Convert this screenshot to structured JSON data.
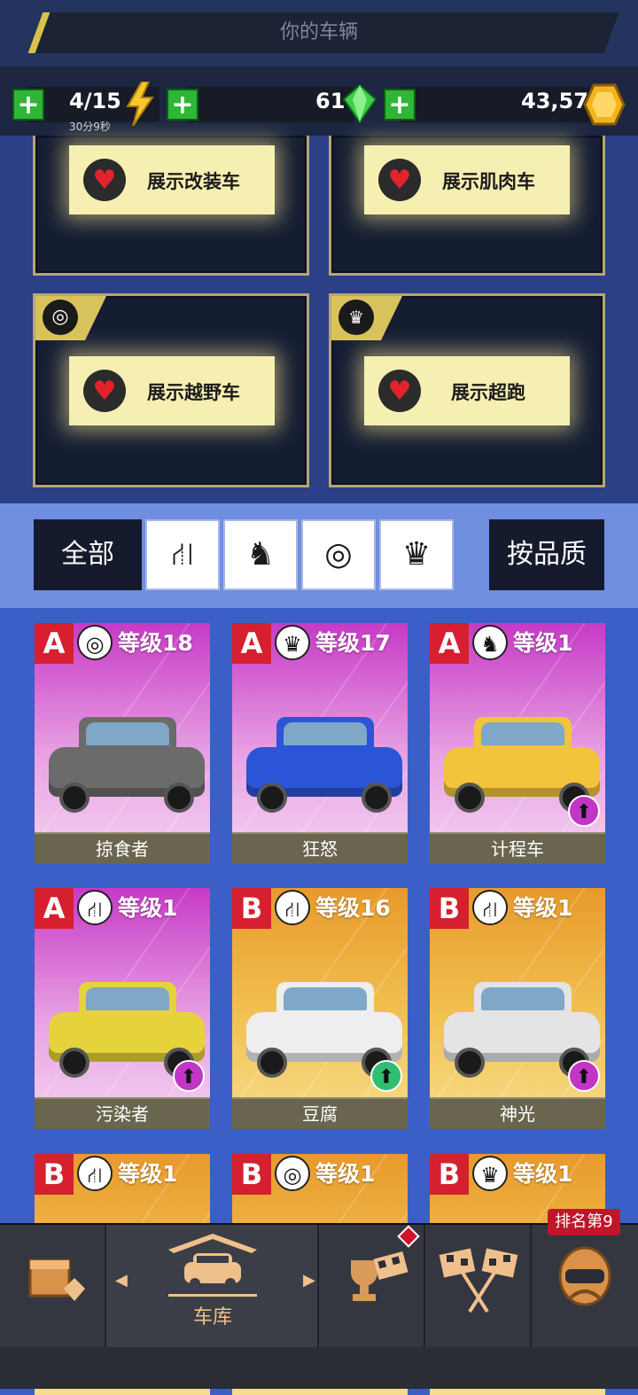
{
  "header": {
    "title": "你的车辆"
  },
  "resources": {
    "energy": {
      "value": "4/15",
      "timer": "30分9秒"
    },
    "gems": {
      "value": "61"
    },
    "coins": {
      "value": "43,577"
    }
  },
  "showcase": [
    {
      "label": "展示改装车",
      "icon": ""
    },
    {
      "label": "展示肌肉车",
      "icon": ""
    },
    {
      "label": "展示越野车",
      "icon": "wheel-icon"
    },
    {
      "label": "展示超跑",
      "icon": "crown-icon"
    }
  ],
  "filters": {
    "all_label": "全部",
    "sort_label": "按品质",
    "icons": [
      "road-icon",
      "horse-icon",
      "wheel-icon",
      "crown-icon"
    ]
  },
  "level_prefix": "等级",
  "cars": [
    {
      "grade": "A",
      "class_icon": "wheel-icon",
      "level": "等级18",
      "name": "掠食者",
      "theme": "pink",
      "upgrade": false,
      "color": "#6b6b6b"
    },
    {
      "grade": "A",
      "class_icon": "crown-icon",
      "level": "等级17",
      "name": "狂怒",
      "theme": "pink",
      "upgrade": false,
      "color": "#2a55d6"
    },
    {
      "grade": "A",
      "class_icon": "horse-icon",
      "level": "等级1",
      "name": "计程车",
      "theme": "pink",
      "upgrade": true,
      "upgrade_color": "#c235c6",
      "color": "#f2c43b"
    },
    {
      "grade": "A",
      "class_icon": "road-icon",
      "level": "等级1",
      "name": "污染者",
      "theme": "pink",
      "upgrade": true,
      "upgrade_color": "#c235c6",
      "color": "#e6d23a"
    },
    {
      "grade": "B",
      "class_icon": "road-icon",
      "level": "等级16",
      "name": "豆腐",
      "theme": "gold",
      "upgrade": true,
      "upgrade_color": "#2fbf73",
      "color": "#eeeeee"
    },
    {
      "grade": "B",
      "class_icon": "road-icon",
      "level": "等级1",
      "name": "神光",
      "theme": "gold",
      "upgrade": true,
      "upgrade_color": "#c235c6",
      "color": "#e4e4e4"
    },
    {
      "grade": "B",
      "class_icon": "road-icon",
      "level": "等级1",
      "name": "",
      "theme": "gold",
      "upgrade": false,
      "color": "#ffffff"
    },
    {
      "grade": "B",
      "class_icon": "wheel-icon",
      "level": "等级1",
      "name": "",
      "theme": "gold",
      "upgrade": false,
      "color": "#ffffff"
    },
    {
      "grade": "B",
      "class_icon": "crown-icon",
      "level": "等级1",
      "name": "",
      "theme": "gold",
      "upgrade": false,
      "color": "#ffffff"
    }
  ],
  "nav": {
    "garage_label": "车库",
    "rank_label": "排名第9"
  },
  "colors": {
    "accent_gold": "#d8c25c",
    "grade_red": "#d6202f",
    "plus_green": "#2fb636"
  }
}
